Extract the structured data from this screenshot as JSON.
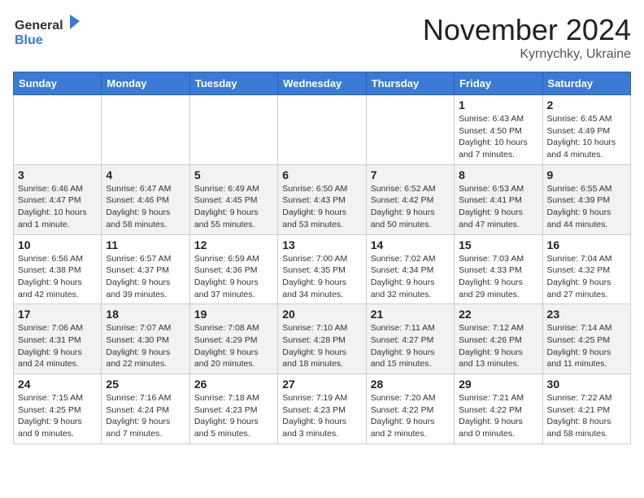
{
  "header": {
    "logo_general": "General",
    "logo_blue": "Blue",
    "month_title": "November 2024",
    "location": "Kyrnychky, Ukraine"
  },
  "weekdays": [
    "Sunday",
    "Monday",
    "Tuesday",
    "Wednesday",
    "Thursday",
    "Friday",
    "Saturday"
  ],
  "weeks": [
    [
      {
        "day": "",
        "info": ""
      },
      {
        "day": "",
        "info": ""
      },
      {
        "day": "",
        "info": ""
      },
      {
        "day": "",
        "info": ""
      },
      {
        "day": "",
        "info": ""
      },
      {
        "day": "1",
        "info": "Sunrise: 6:43 AM\nSunset: 4:50 PM\nDaylight: 10 hours and 7 minutes."
      },
      {
        "day": "2",
        "info": "Sunrise: 6:45 AM\nSunset: 4:49 PM\nDaylight: 10 hours and 4 minutes."
      }
    ],
    [
      {
        "day": "3",
        "info": "Sunrise: 6:46 AM\nSunset: 4:47 PM\nDaylight: 10 hours and 1 minute."
      },
      {
        "day": "4",
        "info": "Sunrise: 6:47 AM\nSunset: 4:46 PM\nDaylight: 9 hours and 58 minutes."
      },
      {
        "day": "5",
        "info": "Sunrise: 6:49 AM\nSunset: 4:45 PM\nDaylight: 9 hours and 55 minutes."
      },
      {
        "day": "6",
        "info": "Sunrise: 6:50 AM\nSunset: 4:43 PM\nDaylight: 9 hours and 53 minutes."
      },
      {
        "day": "7",
        "info": "Sunrise: 6:52 AM\nSunset: 4:42 PM\nDaylight: 9 hours and 50 minutes."
      },
      {
        "day": "8",
        "info": "Sunrise: 6:53 AM\nSunset: 4:41 PM\nDaylight: 9 hours and 47 minutes."
      },
      {
        "day": "9",
        "info": "Sunrise: 6:55 AM\nSunset: 4:39 PM\nDaylight: 9 hours and 44 minutes."
      }
    ],
    [
      {
        "day": "10",
        "info": "Sunrise: 6:56 AM\nSunset: 4:38 PM\nDaylight: 9 hours and 42 minutes."
      },
      {
        "day": "11",
        "info": "Sunrise: 6:57 AM\nSunset: 4:37 PM\nDaylight: 9 hours and 39 minutes."
      },
      {
        "day": "12",
        "info": "Sunrise: 6:59 AM\nSunset: 4:36 PM\nDaylight: 9 hours and 37 minutes."
      },
      {
        "day": "13",
        "info": "Sunrise: 7:00 AM\nSunset: 4:35 PM\nDaylight: 9 hours and 34 minutes."
      },
      {
        "day": "14",
        "info": "Sunrise: 7:02 AM\nSunset: 4:34 PM\nDaylight: 9 hours and 32 minutes."
      },
      {
        "day": "15",
        "info": "Sunrise: 7:03 AM\nSunset: 4:33 PM\nDaylight: 9 hours and 29 minutes."
      },
      {
        "day": "16",
        "info": "Sunrise: 7:04 AM\nSunset: 4:32 PM\nDaylight: 9 hours and 27 minutes."
      }
    ],
    [
      {
        "day": "17",
        "info": "Sunrise: 7:06 AM\nSunset: 4:31 PM\nDaylight: 9 hours and 24 minutes."
      },
      {
        "day": "18",
        "info": "Sunrise: 7:07 AM\nSunset: 4:30 PM\nDaylight: 9 hours and 22 minutes."
      },
      {
        "day": "19",
        "info": "Sunrise: 7:08 AM\nSunset: 4:29 PM\nDaylight: 9 hours and 20 minutes."
      },
      {
        "day": "20",
        "info": "Sunrise: 7:10 AM\nSunset: 4:28 PM\nDaylight: 9 hours and 18 minutes."
      },
      {
        "day": "21",
        "info": "Sunrise: 7:11 AM\nSunset: 4:27 PM\nDaylight: 9 hours and 15 minutes."
      },
      {
        "day": "22",
        "info": "Sunrise: 7:12 AM\nSunset: 4:26 PM\nDaylight: 9 hours and 13 minutes."
      },
      {
        "day": "23",
        "info": "Sunrise: 7:14 AM\nSunset: 4:25 PM\nDaylight: 9 hours and 11 minutes."
      }
    ],
    [
      {
        "day": "24",
        "info": "Sunrise: 7:15 AM\nSunset: 4:25 PM\nDaylight: 9 hours and 9 minutes."
      },
      {
        "day": "25",
        "info": "Sunrise: 7:16 AM\nSunset: 4:24 PM\nDaylight: 9 hours and 7 minutes."
      },
      {
        "day": "26",
        "info": "Sunrise: 7:18 AM\nSunset: 4:23 PM\nDaylight: 9 hours and 5 minutes."
      },
      {
        "day": "27",
        "info": "Sunrise: 7:19 AM\nSunset: 4:23 PM\nDaylight: 9 hours and 3 minutes."
      },
      {
        "day": "28",
        "info": "Sunrise: 7:20 AM\nSunset: 4:22 PM\nDaylight: 9 hours and 2 minutes."
      },
      {
        "day": "29",
        "info": "Sunrise: 7:21 AM\nSunset: 4:22 PM\nDaylight: 9 hours and 0 minutes."
      },
      {
        "day": "30",
        "info": "Sunrise: 7:22 AM\nSunset: 4:21 PM\nDaylight: 8 hours and 58 minutes."
      }
    ]
  ]
}
